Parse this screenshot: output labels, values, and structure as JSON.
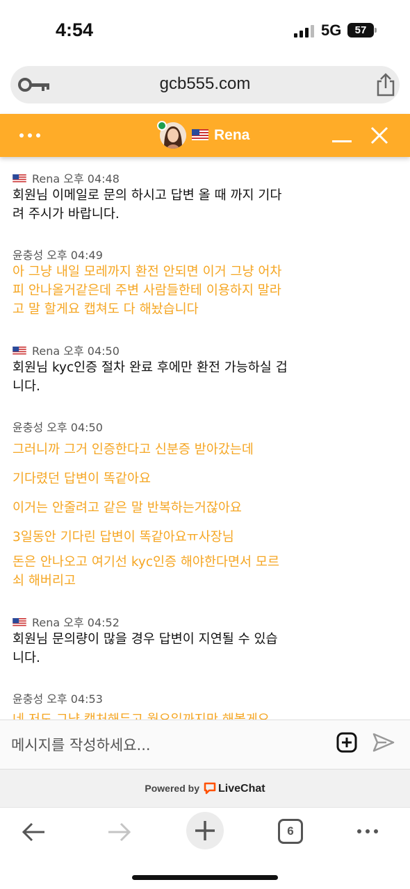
{
  "status_bar": {
    "time": "4:54",
    "network": "5G",
    "battery": "57"
  },
  "browser": {
    "url": "gcb555.com",
    "open_tabs": "6"
  },
  "chat_header": {
    "agent_name": "Rena",
    "colors": {
      "header_bg": "#ffac28",
      "user_text": "#f5a623"
    }
  },
  "messages": [
    {
      "author": "Rena",
      "time": "오후 04:48",
      "from_agent": true,
      "lines": [
        "회원님 이메일로 문의 하시고 답변 올 때 까지 기다",
        "려 주시가 바랍니다."
      ]
    },
    {
      "author": "윤충성",
      "time": "오후 04:49",
      "from_agent": false,
      "lines": [
        "아 그냥 내일 모레까지 환전 안되면 이거 그냥 어차",
        "피 안나올거같은데 주변 사람들한테 이용하지 말라",
        "고 말 할게요 캡쳐도 다 해놨습니다"
      ]
    },
    {
      "author": "Rena",
      "time": "오후 04:50",
      "from_agent": true,
      "lines": [
        "회원님 kyc인증 절차 완료 후에만 환전 가능하실 겁",
        "니다."
      ]
    },
    {
      "author": "윤충성",
      "time": "오후 04:50",
      "from_agent": false,
      "lines": [
        "그러니까 그거 인증한다고 신분증 받아갔는데"
      ]
    },
    {
      "author": "",
      "time": "",
      "from_agent": false,
      "lines": [
        "기다렸던 답변이 똑같아요"
      ]
    },
    {
      "author": "",
      "time": "",
      "from_agent": false,
      "lines": [
        "이거는 안줄려고 같은 말 반복하는거잖아요"
      ]
    },
    {
      "author": "",
      "time": "",
      "from_agent": false,
      "lines": [
        "3일동안 기다린 답변이 똑같아요ㅠ사장님"
      ]
    },
    {
      "author": "",
      "time": "",
      "from_agent": false,
      "lines": [
        "돈은 안나오고 여기선 kyc인증 해야한다면서 모르",
        "쇠 해버리고"
      ]
    },
    {
      "author": "Rena",
      "time": "오후 04:52",
      "from_agent": true,
      "lines": [
        "회원님 문의량이 많을 경우 답변이 지연될 수 있습",
        "니다."
      ]
    },
    {
      "author": "윤충성",
      "time": "오후 04:53",
      "from_agent": false,
      "lines": [
        "네 저도 그냥 캡처해두고 월요일까지만 해볼게요"
      ]
    }
  ],
  "composer": {
    "placeholder": "메시지를 작성하세요..."
  },
  "footer": {
    "powered_by": "Powered by",
    "brand": "LiveChat"
  },
  "icons": [
    "key-icon",
    "share-icon",
    "menu-dots-icon",
    "avatar",
    "flag-us-icon",
    "minimize-icon",
    "close-icon",
    "add-attachment-icon",
    "send-icon",
    "livechat-logo-icon",
    "back-arrow-icon",
    "forward-arrow-icon",
    "plus-icon",
    "more-dots-icon"
  ]
}
